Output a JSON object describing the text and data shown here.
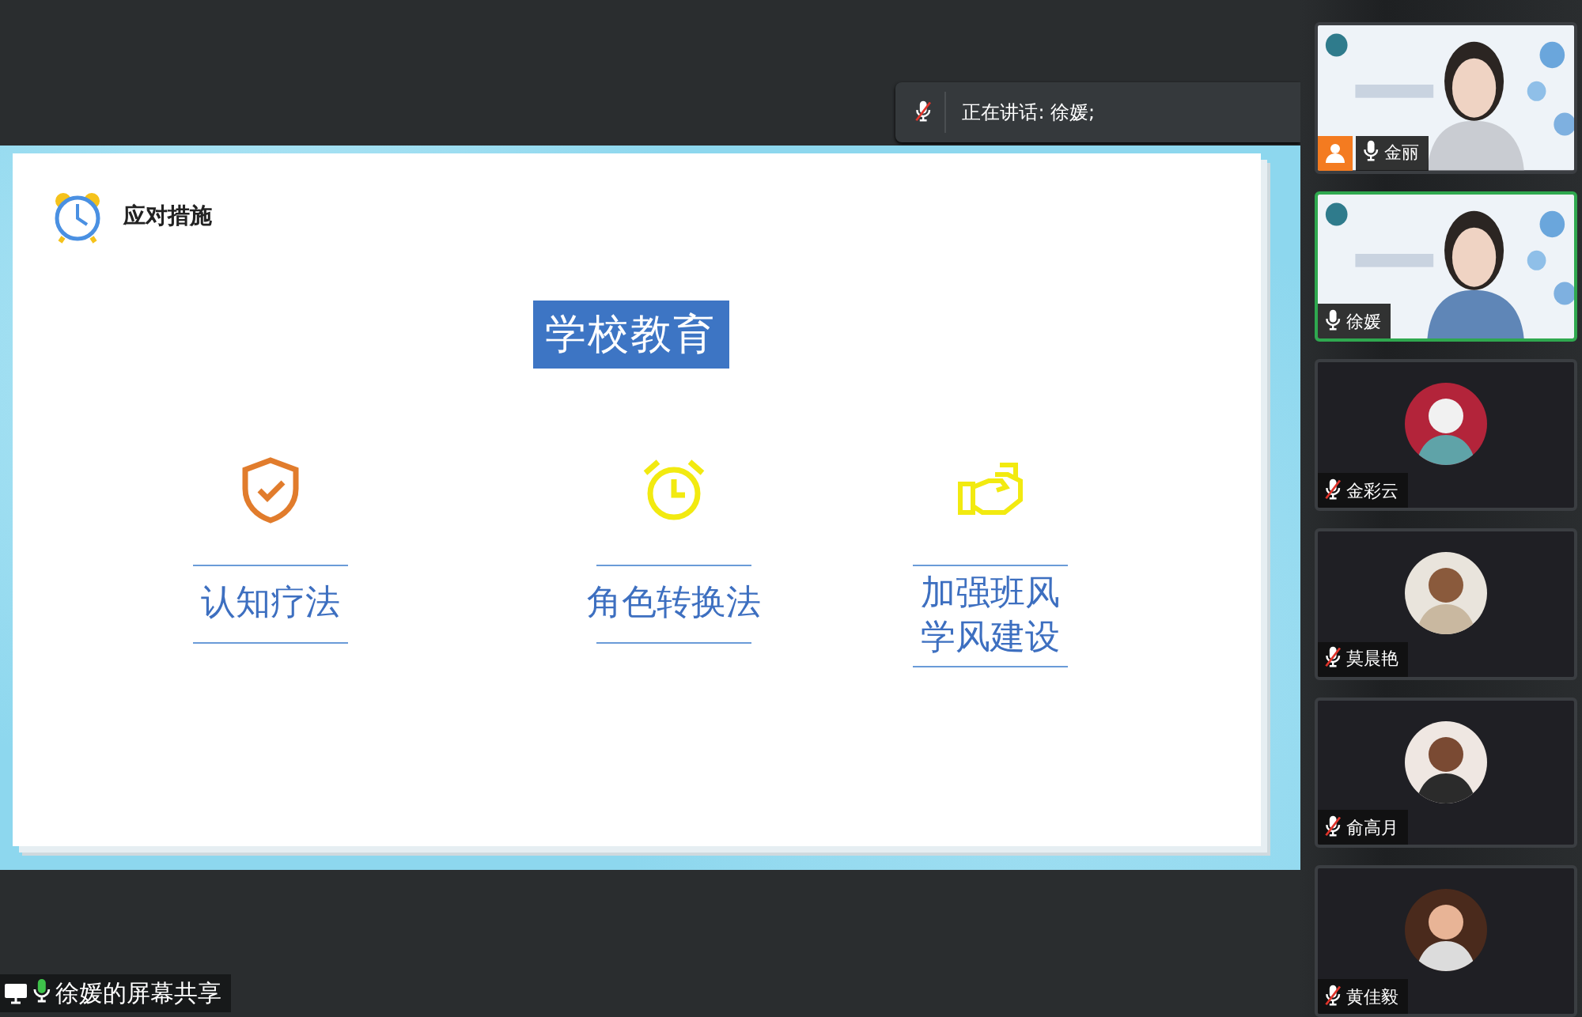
{
  "speaking_bar": {
    "label": "正在讲话: 徐媛;",
    "mic_muted": true
  },
  "slide": {
    "header": "应对措施",
    "title": "学校教育",
    "items": [
      {
        "kind": "shield",
        "lines": [
          "认知疗法"
        ]
      },
      {
        "kind": "alarm",
        "lines": [
          "角色转换法"
        ]
      },
      {
        "kind": "hand",
        "lines": [
          "加强班风",
          "学风建设"
        ]
      }
    ]
  },
  "participants": [
    {
      "kind": "video",
      "name": "金丽",
      "host": true,
      "muted": false,
      "active": false
    },
    {
      "kind": "video",
      "name": "徐媛",
      "host": false,
      "muted": false,
      "active": true
    },
    {
      "kind": "avatar",
      "name": "金彩云",
      "host": false,
      "muted": true,
      "active": false
    },
    {
      "kind": "avatar",
      "name": "莫晨艳",
      "host": false,
      "muted": true,
      "active": false
    },
    {
      "kind": "avatar",
      "name": "俞高月",
      "host": false,
      "muted": true,
      "active": false
    },
    {
      "kind": "avatar",
      "name": "黄佳毅",
      "host": false,
      "muted": true,
      "active": false
    }
  ],
  "share_label": {
    "text": "徐媛的屏幕共享",
    "mic_on": true
  }
}
